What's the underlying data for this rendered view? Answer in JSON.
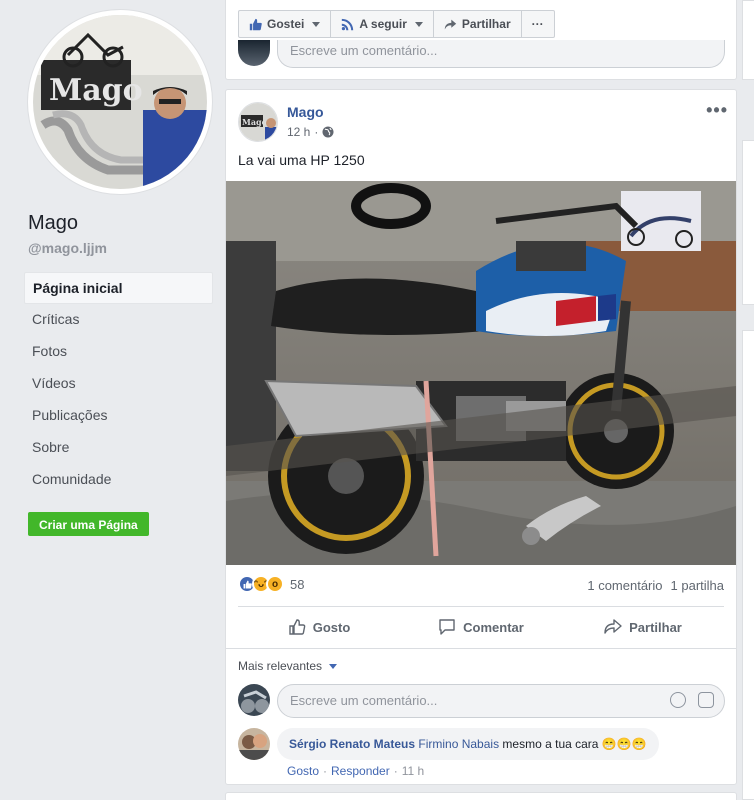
{
  "page": {
    "name": "Mago",
    "handle": "@mago.ljjm"
  },
  "nav": [
    {
      "label": "Página inicial",
      "active": true
    },
    {
      "label": "Críticas"
    },
    {
      "label": "Fotos"
    },
    {
      "label": "Vídeos"
    },
    {
      "label": "Publicações"
    },
    {
      "label": "Sobre"
    },
    {
      "label": "Comunidade"
    }
  ],
  "create_page_label": "Criar uma Página",
  "page_actions": {
    "like": "Gostei",
    "follow": "A seguir",
    "share": "Partilhar",
    "more": "···"
  },
  "prev_comment_placeholder": "Escreve um comentário...",
  "post": {
    "author": "Mago",
    "time": "12 h",
    "text": "La vai uma HP 1250",
    "reaction_count": "58",
    "comments_count": "1 comentário",
    "shares_count": "1 partilha",
    "buttons": {
      "like": "Gosto",
      "comment": "Comentar",
      "share": "Partilhar"
    },
    "sort_label": "Mais relevantes",
    "comment_placeholder": "Escreve um comentário..."
  },
  "comment": {
    "author": "Sérgio Renato Mateus",
    "tag": "Firmino Nabais",
    "body": "mesmo a tua cara 😁😁😁",
    "like": "Gosto",
    "reply": "Responder",
    "time": "11 h"
  },
  "colors": {
    "link": "#365899",
    "create_button": "#42b72a",
    "background": "#e9ebee"
  }
}
